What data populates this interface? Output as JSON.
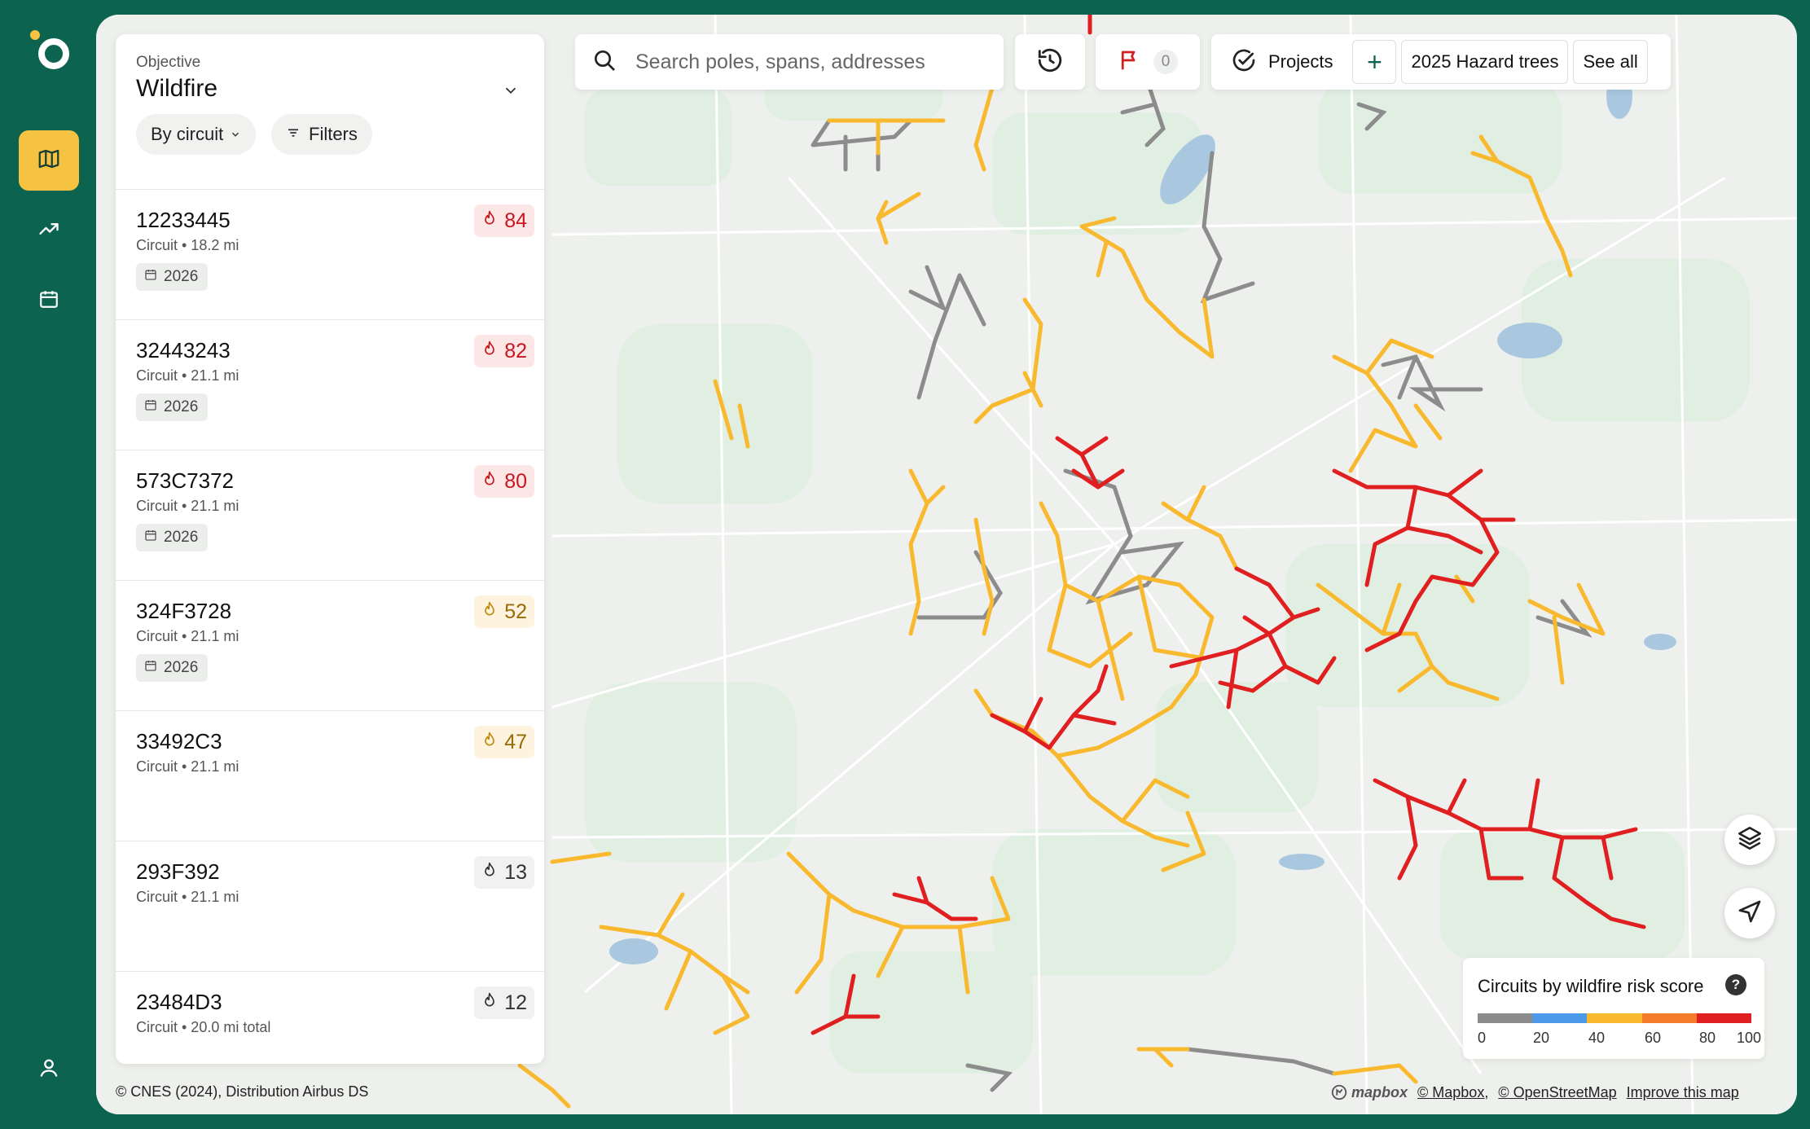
{
  "sidebar": {
    "logo_icon": "company-logo",
    "items": [
      {
        "name": "map",
        "icon": "map-icon",
        "active": true
      },
      {
        "name": "trends",
        "icon": "trending-up-icon",
        "active": false
      },
      {
        "name": "calendar",
        "icon": "calendar-icon",
        "active": false
      }
    ],
    "profile_icon": "user-icon"
  },
  "panel": {
    "objective_label": "Objective",
    "objective_value": "Wildfire",
    "group_by_label": "By circuit",
    "filters_label": "Filters",
    "circuits": [
      {
        "id": "12233445",
        "subtitle": "Circuit • 18.2 mi",
        "year": "2026",
        "score": "84",
        "risk": "high"
      },
      {
        "id": "32443243",
        "subtitle": "Circuit • 21.1 mi",
        "year": "2026",
        "score": "82",
        "risk": "high"
      },
      {
        "id": "573C7372",
        "subtitle": "Circuit • 21.1 mi",
        "year": "2026",
        "score": "80",
        "risk": "high"
      },
      {
        "id": "324F3728",
        "subtitle": "Circuit • 21.1 mi",
        "year": "2026",
        "score": "52",
        "risk": "medium"
      },
      {
        "id": "33492C3",
        "subtitle": "Circuit • 21.1 mi",
        "year": "",
        "score": "47",
        "risk": "medium"
      },
      {
        "id": "293F392",
        "subtitle": "Circuit •  21.1 mi",
        "year": "",
        "score": "13",
        "risk": "low"
      },
      {
        "id": "23484D3",
        "subtitle": "Circuit • 20.0 mi total",
        "year": "",
        "score": "12",
        "risk": "low"
      }
    ]
  },
  "toolbar": {
    "search_placeholder": "Search poles, spans, addresses",
    "flag_count": "0",
    "projects_label": "Projects",
    "add_label": "+",
    "project_chip": "2025 Hazard trees",
    "see_all_label": "See all"
  },
  "legend": {
    "title": "Circuits by wildfire risk score",
    "help": "?",
    "colors": [
      "#8c8c8c",
      "#4d9be8",
      "#f9b92e",
      "#f47b2a",
      "#e02020"
    ],
    "ticks": [
      "0",
      "20",
      "40",
      "60",
      "80",
      "100"
    ]
  },
  "attribution": {
    "left": "© CNES (2024), Distribution Airbus DS",
    "mapbox_logo": "mapbox",
    "links": [
      "© Mapbox,",
      "© OpenStreetMap",
      "Improve this map"
    ]
  },
  "colors": {
    "brand": "#0b6350",
    "accent": "#f5c242",
    "high": "#e02020",
    "medium": "#f9b92e",
    "none": "#8c8c8c"
  }
}
